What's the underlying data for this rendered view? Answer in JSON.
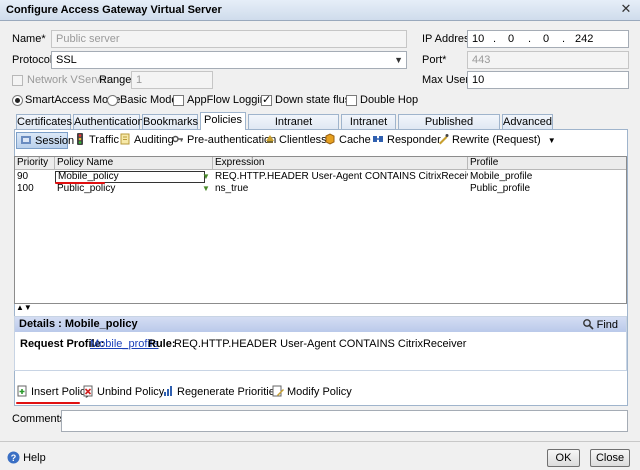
{
  "window": {
    "title": "Configure Access Gateway Virtual Server",
    "close_glyph": "✕"
  },
  "form": {
    "name_label": "Name*",
    "name_value": "Public server",
    "protocol_label": "Protocol*",
    "protocol_value": "SSL",
    "network_vserver_label": "Network VServer",
    "network_vserver_checked": false,
    "range_label": "Range",
    "range_value": "1",
    "ip_label": "IP Address",
    "ip_octets": [
      "10",
      "0",
      "0",
      "242"
    ],
    "port_label": "Port*",
    "port_value": "443",
    "max_users_label": "Max Users",
    "max_users_value": "10"
  },
  "options": {
    "smartaccess_label": "SmartAccess Mode",
    "smartaccess_selected": true,
    "basic_label": "Basic Mode",
    "basic_selected": false,
    "appflow_label": "AppFlow Logging",
    "appflow_checked": false,
    "down_state_label": "Down state flush",
    "down_state_checked": true,
    "double_hop_label": "Double Hop",
    "double_hop_checked": false
  },
  "tabs": [
    "Certificates",
    "Authentication",
    "Bookmarks",
    "Policies",
    "Intranet Applications",
    "Intranet IPs",
    "Published Applications",
    "Advanced"
  ],
  "active_tab": "Policies",
  "policy_types": [
    "Session",
    "Traffic",
    "Auditing",
    "Pre-authentication",
    "Clientless",
    "Cache",
    "Responder",
    "Rewrite (Request)"
  ],
  "active_policy_type": "Session",
  "table": {
    "columns": [
      "Priority",
      "Policy Name",
      "Expression",
      "Profile"
    ],
    "rows": [
      {
        "priority": "90",
        "name": "Mobile_policy",
        "expression": "REQ.HTTP.HEADER User-Agent CONTAINS CitrixReceiver",
        "profile": "Mobile_profile"
      },
      {
        "priority": "100",
        "name": "Public_policy",
        "expression": "ns_true",
        "profile": "Public_profile"
      }
    ]
  },
  "details": {
    "header": "Details : Mobile_policy",
    "find_label": "Find",
    "request_profile_label": "Request Profile:",
    "request_profile_value": "Mobile_profile",
    "rule_label": "Rule:",
    "rule_value": "REQ.HTTP.HEADER User-Agent CONTAINS CitrixReceiver"
  },
  "actions": [
    "Insert Policy",
    "Unbind Policy",
    "Regenerate Priorities",
    "Modify Policy"
  ],
  "comments_label": "Comments",
  "comments_value": "",
  "footer": {
    "help_label": "Help",
    "ok_label": "OK",
    "close_label": "Close"
  },
  "colors": {
    "accent_red": "#e01010",
    "details_header": "#c8d3ef",
    "link": "#1a3fb8"
  }
}
